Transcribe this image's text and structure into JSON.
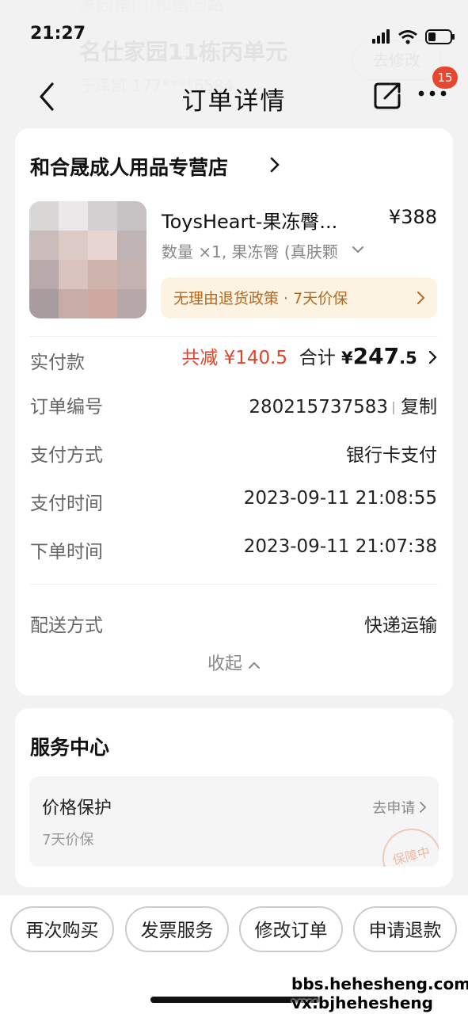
{
  "background": {
    "address_top": "家园南门·和谐园路",
    "address": "名仕家园11栋丙单元",
    "contact": "于泽凯 177****6584",
    "edit_label": "去修改"
  },
  "status_bar": {
    "time": "21:27"
  },
  "nav": {
    "title": "订单详情",
    "badge_count": "15"
  },
  "order": {
    "store_name": "和合晟成人用品专营店",
    "product": {
      "name": "ToysHeart-果冻臀...",
      "price": "¥388",
      "spec": "数量 ×1, 果冻臀 (真肤颗",
      "policy": "无理由退货政策 · 7天价保"
    },
    "payment": {
      "label": "实付款",
      "discount": "共减 ¥140.5",
      "total_label": "合计",
      "total_currency": "¥",
      "total_int": "247",
      "total_dec": ".5"
    },
    "rows": [
      {
        "label": "订单编号",
        "value": "280215737583"
      },
      {
        "label": "支付方式",
        "value": "银行卡支付"
      },
      {
        "label": "支付时间",
        "value": "2023-09-11 21:08:55"
      },
      {
        "label": "下单时间",
        "value": "2023-09-11 21:07:38"
      }
    ],
    "copy_label": "复制",
    "delivery": {
      "label": "配送方式",
      "value": "快递运输"
    },
    "collapse_label": "收起"
  },
  "service": {
    "title": "服务中心",
    "item_title": "价格保护",
    "item_sub": "7天价保",
    "apply_label": "去申请",
    "stamp": "保障中"
  },
  "actions": [
    "再次购买",
    "发票服务",
    "修改订单",
    "申请退款"
  ],
  "watermark": {
    "line1": "bbs.hehesheng.com",
    "line2": "vx:bjhehesheng"
  },
  "colors": {
    "accent_red": "#e0442a",
    "policy_text": "#b7671f",
    "badge": "#e8462f"
  }
}
